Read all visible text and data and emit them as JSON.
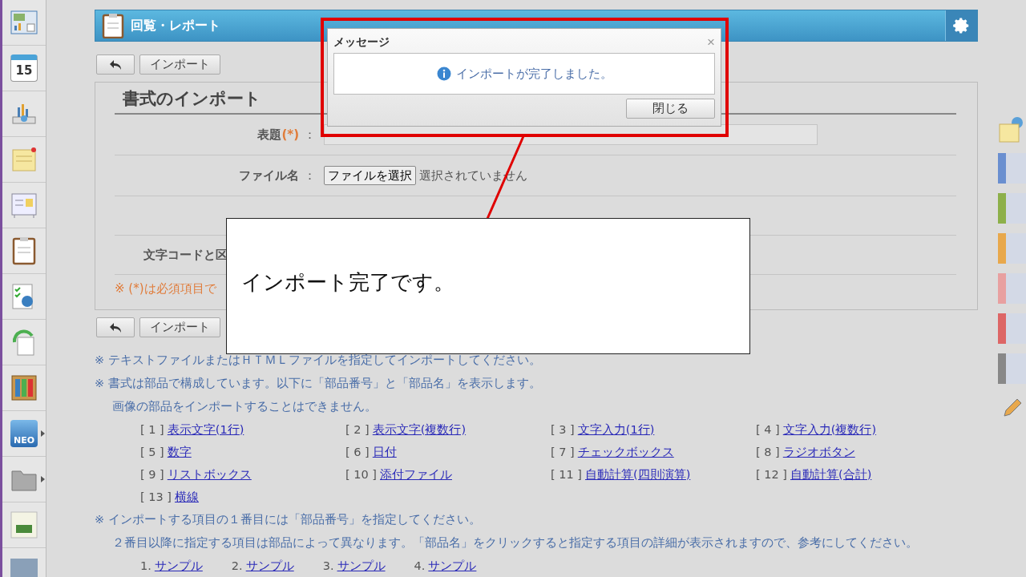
{
  "sidebar": {
    "items": [
      {
        "kind": "dashboard",
        "submenu": false
      },
      {
        "kind": "calendar",
        "text": "15",
        "submenu": false
      },
      {
        "kind": "chart",
        "submenu": false
      },
      {
        "kind": "memo",
        "submenu": false
      },
      {
        "kind": "board",
        "submenu": false
      },
      {
        "kind": "clipboard",
        "submenu": false
      },
      {
        "kind": "survey",
        "submenu": false
      },
      {
        "kind": "refresh",
        "submenu": false
      },
      {
        "kind": "binders",
        "submenu": false
      },
      {
        "kind": "neo",
        "text": "NEO",
        "submenu": true
      },
      {
        "kind": "folder",
        "submenu": true
      },
      {
        "kind": "logo",
        "submenu": false
      },
      {
        "kind": "photo",
        "submenu": false
      }
    ]
  },
  "header": {
    "title": "回覧・レポート"
  },
  "toolbar": {
    "buttons": [
      "インポート"
    ]
  },
  "form": {
    "title": "書式のインポート",
    "fields": [
      {
        "kind": "text",
        "label": "表題",
        "required": "(*)",
        "separator": "："
      },
      {
        "kind": "file",
        "label": "ファイル名",
        "separator": "：",
        "button": "ファイルを選択",
        "status": "選択されていません"
      },
      {
        "kind": "label",
        "label": "文字コードと区"
      }
    ],
    "required_note": "※ (*)は必須項目で"
  },
  "bottom_toolbar": {
    "buttons": [
      "インポート"
    ]
  },
  "notes": [
    {
      "kind": "para",
      "mark": "※",
      "text": "テキストファイルまたはＨＴＭＬファイルを指定してインポートしてください。"
    },
    {
      "kind": "para",
      "mark": "※",
      "text": "書式は部品で構成しています。以下に「部品番号」と「部品名」を表示します。"
    },
    {
      "kind": "sub",
      "text": "画像の部品をインポートすることはできません。"
    },
    {
      "kind": "grid",
      "items": [
        {
          "number": "[ 1 ]",
          "link": "表示文字(1行)"
        },
        {
          "number": "[ 2 ]",
          "link": "表示文字(複数行)"
        },
        {
          "number": "[ 3 ]",
          "link": "文字入力(1行)"
        },
        {
          "number": "[ 4 ]",
          "link": "文字入力(複数行)"
        },
        {
          "number": "[ 5 ]",
          "link": "数字"
        },
        {
          "number": "[ 6 ]",
          "link": "日付"
        },
        {
          "number": "[ 7 ]",
          "link": "チェックボックス"
        },
        {
          "number": "[ 8 ]",
          "link": "ラジオボタン"
        },
        {
          "number": "[ 9 ]",
          "link": "リストボックス"
        },
        {
          "number": "[ 10 ]",
          "link": "添付ファイル"
        },
        {
          "number": "[ 11 ]",
          "link": "自動計算(四則演算)"
        },
        {
          "number": "[ 12 ]",
          "link": "自動計算(合計)"
        },
        {
          "number": "[ 13 ]",
          "link": "横線"
        }
      ]
    },
    {
      "kind": "para",
      "mark": "※",
      "text": "インポートする項目の１番目には「部品番号」を指定してください。"
    },
    {
      "kind": "sub",
      "text": "２番目以降に指定する項目は部品によって異なります。「部品名」をクリックすると指定する項目の詳細が表示されますので、参考にしてください。"
    },
    {
      "kind": "samples",
      "items": [
        {
          "number": "1.",
          "link": "サンプル"
        },
        {
          "number": "2.",
          "link": "サンプル"
        },
        {
          "number": "3.",
          "link": "サンプル"
        },
        {
          "number": "4.",
          "link": "サンプル"
        }
      ]
    }
  ],
  "right_tabs": [
    {
      "color": "#6a8fd0"
    },
    {
      "color": "#8db04a"
    },
    {
      "color": "#e8a84c"
    },
    {
      "color": "#e8a0a0"
    },
    {
      "color": "#dd6666"
    },
    {
      "color": "#888888"
    }
  ],
  "dialog": {
    "title": "メッセージ",
    "close": "×",
    "message": "インポートが完了しました。",
    "button": "閉じる"
  },
  "callout": {
    "text": "インポート完了です。"
  }
}
